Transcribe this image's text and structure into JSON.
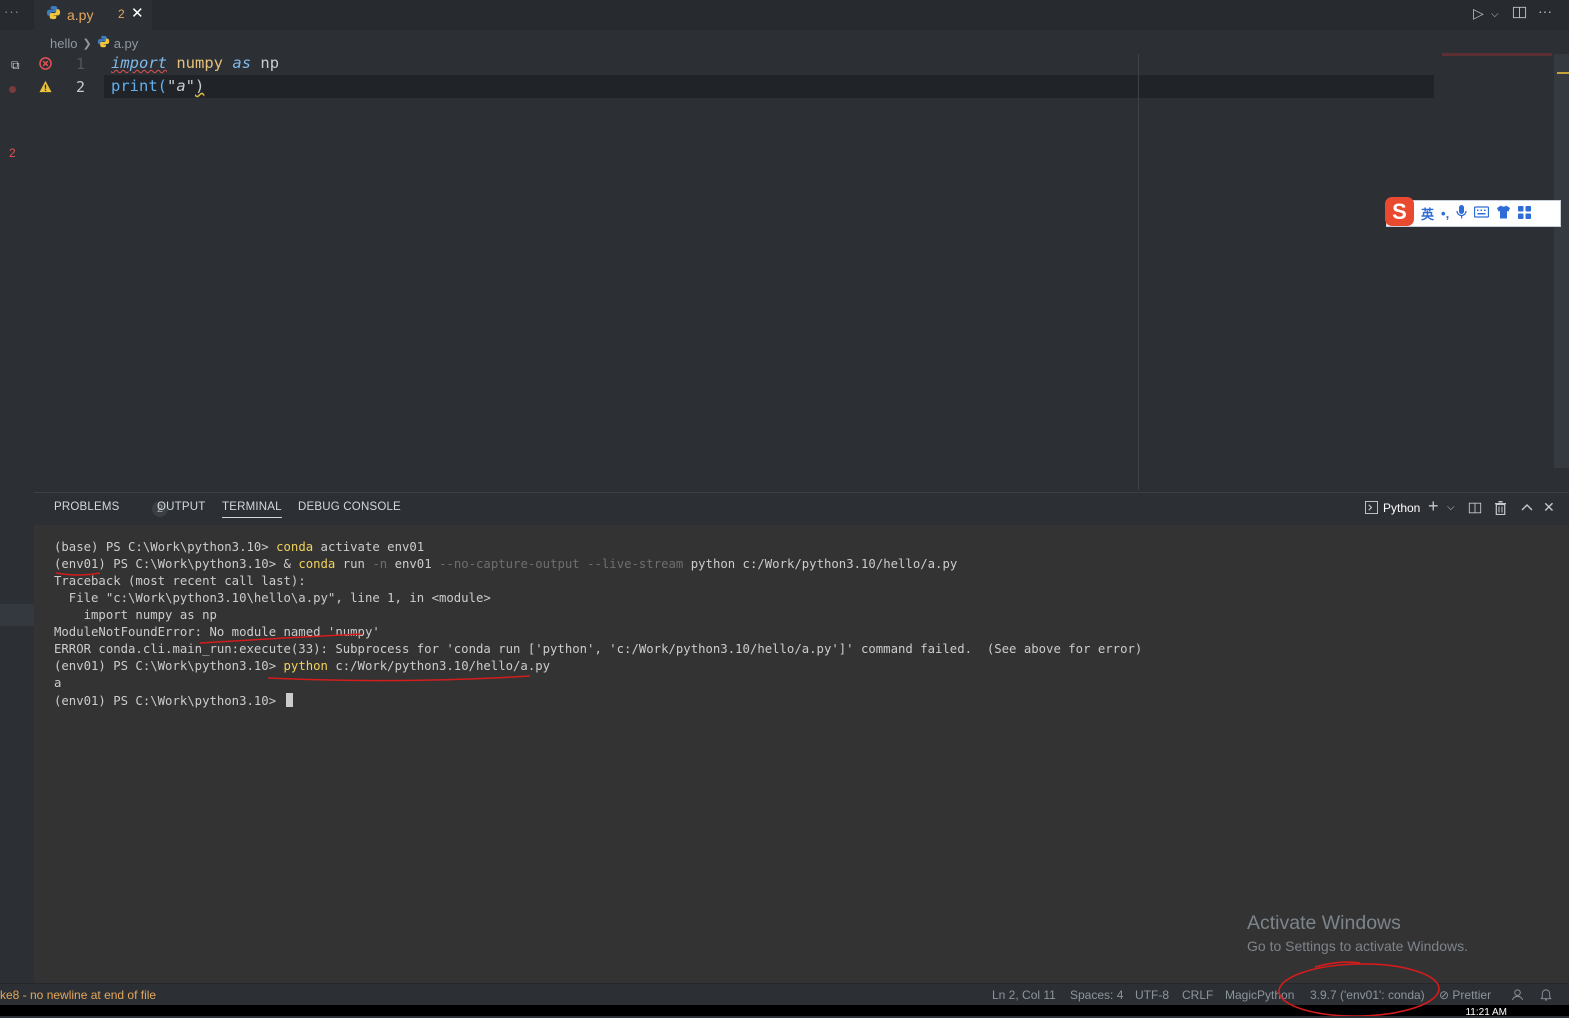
{
  "tab": {
    "file_name": "a.py",
    "problem_count": "2"
  },
  "breadcrumb": {
    "folder": "hello",
    "file": "a.py"
  },
  "editor": {
    "lines": [
      {
        "number": "1",
        "tokens": [
          "import",
          "numpy",
          "as",
          "np"
        ]
      },
      {
        "number": "2",
        "tokens": [
          "print(",
          "\"a\"",
          ")"
        ]
      }
    ],
    "overview_count": "2"
  },
  "ime": {
    "logo": "S",
    "mode": "英",
    "punct": "•,",
    "items": [
      "mic-icon",
      "keyboard-icon",
      "skin-icon",
      "menu-icon"
    ]
  },
  "panel": {
    "tabs": {
      "problems": "PROBLEMS",
      "output": "OUTPUT",
      "terminal": "TERMINAL",
      "debug": "DEBUG CONSOLE"
    },
    "problems_badge": "2",
    "terminal_profile": "Python"
  },
  "terminal": {
    "l1_prompt": "(base) PS C:\\Work\\python3.10> ",
    "l1_cmd": "conda",
    "l1_rest": " activate env01",
    "l2_prompt": "(env01) PS C:\\Work\\python3.10> & ",
    "l2_cmd": "conda",
    "l2_run": " run ",
    "l2_flag1": "-n",
    "l2_env": " env01 ",
    "l2_flags": "--no-capture-output --live-stream",
    "l2_rest": " python c:/Work/python3.10/hello/a.py",
    "l3": "Traceback (most recent call last):",
    "l4": "  File \"c:\\Work\\python3.10\\hello\\a.py\", line 1, in <module>",
    "l5": "    import numpy as np",
    "l6": "ModuleNotFoundError: No module named 'numpy'",
    "l7": "ERROR conda.cli.main_run:execute(33): Subprocess for 'conda run ['python', 'c:/Work/python3.10/hello/a.py']' command failed.  (See above for error)",
    "l8_prompt": "(env01) PS C:\\Work\\python3.10> ",
    "l8_cmd": "python",
    "l8_rest": " c:/Work/python3.10/hello/a.py",
    "l9": "a",
    "l10_prompt": "(env01) PS C:\\Work\\python3.10> "
  },
  "statusbar": {
    "left_message": "ke8 - no newline at end of file",
    "position": "Ln 2, Col 11",
    "spaces": "Spaces: 4",
    "encoding": "UTF-8",
    "eol": "CRLF",
    "language": "MagicPython",
    "interpreter": "3.9.7 ('env01': conda)",
    "prettier": "Prettier",
    "clock": "11:21 AM"
  },
  "watermark": {
    "title": "Activate Windows",
    "subtitle": "Go to Settings to activate Windows."
  },
  "colors": {
    "annotation_red": "#d41c1c",
    "accent_orange": "#e5a65a"
  }
}
